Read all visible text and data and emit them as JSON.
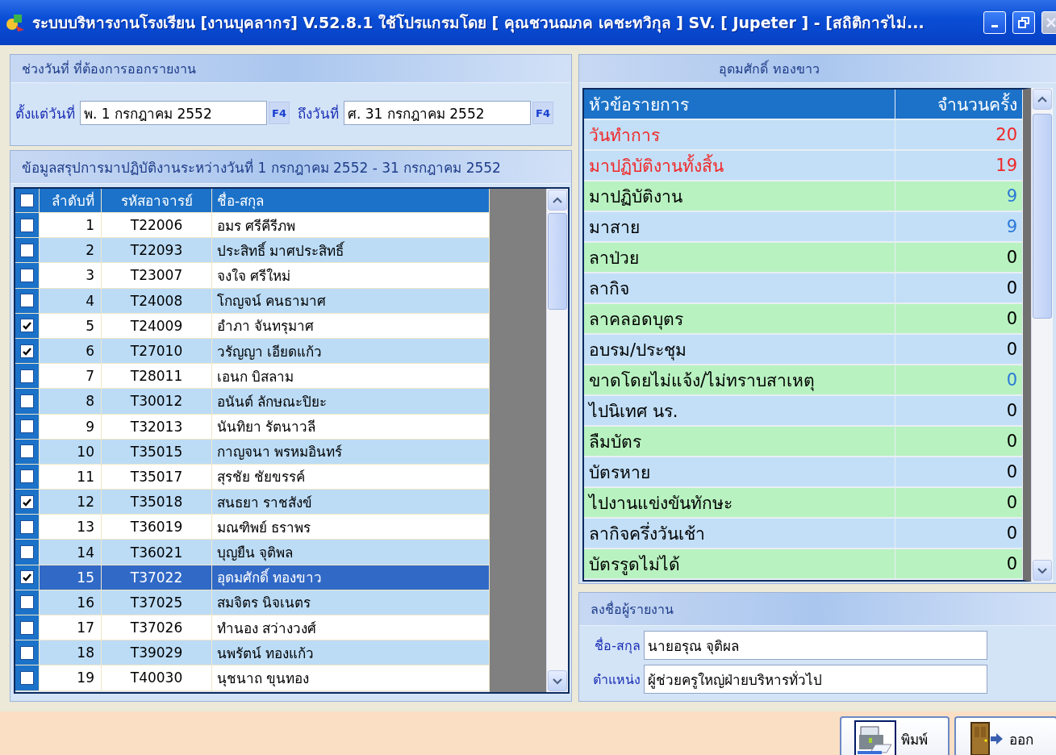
{
  "window": {
    "title": "ระบบบริหารงานโรงเรียน [งานบุคลากร] V.52.8.1 ใช้โปรแกรมโดย [ คุณชวนฌภค  เคชะทวิกุล ] SV. [ Jupeter ]  - [สถิติการไม่..."
  },
  "date_range": {
    "title": "ช่วงวันที่ ที่ต้องการออกรายงาน",
    "from_label": "ตั้งแต่วันที่",
    "from_value": "พ. 1 กรกฎาคม 2552",
    "from_button": "F4",
    "to_label": "ถึงวันที่",
    "to_value": "ศ. 31 กรกฎาคม 2552",
    "to_button": "F4"
  },
  "summary": {
    "title": "ข้อมูลสรุปการมาปฏิบัติงานระหว่างวันที่ 1 กรกฎาคม 2552 - 31 กรกฎาคม 2552",
    "header_checked": false,
    "columns": [
      "ลำดับที่",
      "รหัสอาจารย์",
      "ชื่อ-สกุล"
    ],
    "rows": [
      {
        "no": "1",
        "code": "T22006",
        "name": "อมร ศรีคีรีภพ",
        "checked": false,
        "selected": false
      },
      {
        "no": "2",
        "code": "T22093",
        "name": "ประสิทธิ์ มาศประสิทธิ์",
        "checked": false,
        "selected": false
      },
      {
        "no": "3",
        "code": "T23007",
        "name": "จงใจ ศรีใหม่",
        "checked": false,
        "selected": false
      },
      {
        "no": "4",
        "code": "T24008",
        "name": "โกญจน์ คนธามาศ",
        "checked": false,
        "selected": false
      },
      {
        "no": "5",
        "code": "T24009",
        "name": "อำภา จันทรุมาศ",
        "checked": true,
        "selected": false
      },
      {
        "no": "6",
        "code": "T27010",
        "name": "วรัญญา เอียดแก้ว",
        "checked": true,
        "selected": false
      },
      {
        "no": "7",
        "code": "T28011",
        "name": "เอนก บิสลาม",
        "checked": false,
        "selected": false
      },
      {
        "no": "8",
        "code": "T30012",
        "name": "อนันต์ ลักษณะปิยะ",
        "checked": false,
        "selected": false
      },
      {
        "no": "9",
        "code": "T32013",
        "name": "นันทิยา รัตนาวลี",
        "checked": false,
        "selected": false
      },
      {
        "no": "10",
        "code": "T35015",
        "name": "กาญจนา พรหมอินทร์",
        "checked": false,
        "selected": false
      },
      {
        "no": "11",
        "code": "T35017",
        "name": "สุรชัย ชัยขรรค์",
        "checked": false,
        "selected": false
      },
      {
        "no": "12",
        "code": "T35018",
        "name": "สนธยา ราชสังข์",
        "checked": true,
        "selected": false
      },
      {
        "no": "13",
        "code": "T36019",
        "name": "มณฑิพย์ ธราพร",
        "checked": false,
        "selected": false
      },
      {
        "no": "14",
        "code": "T36021",
        "name": "บุญยืน จุติพล",
        "checked": false,
        "selected": false
      },
      {
        "no": "15",
        "code": "T37022",
        "name": "อุดมศักดิ์ ทองขาว",
        "checked": true,
        "selected": true
      },
      {
        "no": "16",
        "code": "T37025",
        "name": "สมจิตร นิจเนตร",
        "checked": false,
        "selected": false
      },
      {
        "no": "17",
        "code": "T37026",
        "name": "ทำนอง สว่างวงศ์",
        "checked": false,
        "selected": false
      },
      {
        "no": "18",
        "code": "T39029",
        "name": "นพรัตน์ ทองแก้ว",
        "checked": false,
        "selected": false
      },
      {
        "no": "19",
        "code": "T40030",
        "name": "นุชนาถ ขุนทอง",
        "checked": false,
        "selected": false
      }
    ]
  },
  "stats": {
    "title": "อุดมศักดิ์ ทองขาว",
    "columns": [
      "หัวข้อรายการ",
      "จำนวนครั้ง"
    ],
    "rows": [
      {
        "label": "วันทำการ",
        "count": "20",
        "kind": "total",
        "color": "#f02828"
      },
      {
        "label": "มาปฏิบัติงานทั้งสิ้น",
        "count": "19",
        "kind": "total",
        "color": "#f02828"
      },
      {
        "label": "มาปฏิบัติงาน",
        "count": "9",
        "kind": "item",
        "color": "#2a78d8"
      },
      {
        "label": "มาสาย",
        "count": "9",
        "kind": "item",
        "color": "#2a78d8"
      },
      {
        "label": "ลาป่วย",
        "count": "0",
        "kind": "item",
        "color": "#000000"
      },
      {
        "label": "ลากิจ",
        "count": "0",
        "kind": "item",
        "color": "#000000"
      },
      {
        "label": "ลาคลอดบุตร",
        "count": "0",
        "kind": "item",
        "color": "#000000"
      },
      {
        "label": "อบรม/ประชุม",
        "count": "0",
        "kind": "item",
        "color": "#000000"
      },
      {
        "label": "ขาดโดยไม่แจ้ง/ไม่ทราบสาเหตุ",
        "count": "0",
        "kind": "item",
        "color": "#2a78d8"
      },
      {
        "label": "ไปนิเทศ นร.",
        "count": "0",
        "kind": "item",
        "color": "#000000"
      },
      {
        "label": "ลืมบัตร",
        "count": "0",
        "kind": "item",
        "color": "#000000"
      },
      {
        "label": "บัตรหาย",
        "count": "0",
        "kind": "item",
        "color": "#000000"
      },
      {
        "label": "ไปงานแข่งขันทักษะ",
        "count": "0",
        "kind": "item",
        "color": "#000000"
      },
      {
        "label": "ลากิจครึ่งวันเช้า",
        "count": "0",
        "kind": "item",
        "color": "#000000"
      },
      {
        "label": "บัตรรูดไม่ได้",
        "count": "0",
        "kind": "item",
        "color": "#000000"
      }
    ]
  },
  "reporter": {
    "title": "ลงชื่อผู้รายงาน",
    "name_label": "ชื่อ-สกุล",
    "name_value": "นายอรุณ จุติผล",
    "position_label": "ตำแหน่ง",
    "position_value": "ผู้ช่วยครูใหญ่ฝ่ายบริหารทั่วไป"
  },
  "buttons": [
    {
      "kind": "print",
      "label": "พิมพ์"
    },
    {
      "kind": "exit",
      "label": "ออก"
    }
  ]
}
